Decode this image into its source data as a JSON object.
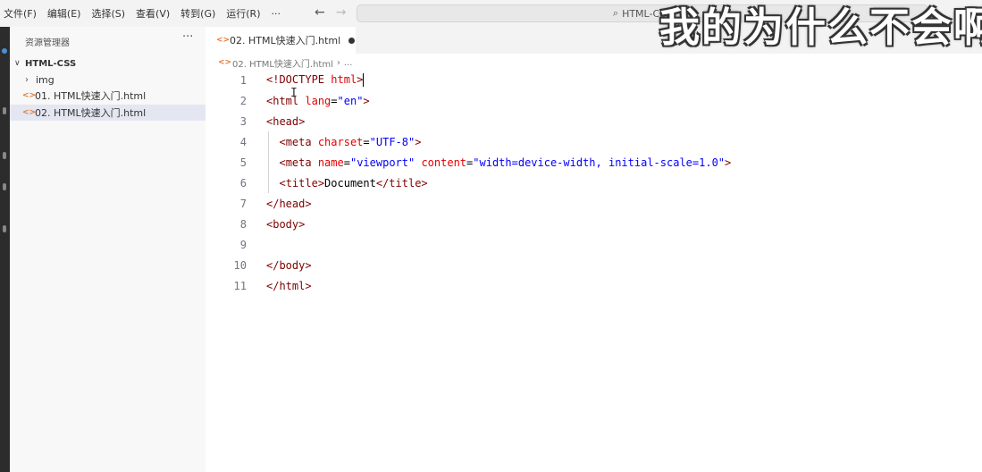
{
  "menu": [
    "文件(F)",
    "编辑(E)",
    "选择(S)",
    "查看(V)",
    "转到(G)",
    "运行(R)",
    "···"
  ],
  "nav": {
    "back": "←",
    "forward": "→"
  },
  "command_center": {
    "label": "HTML-CSS",
    "icon": "search-icon"
  },
  "overlay_caption": "我的为什么不会啊",
  "sidebar": {
    "title": "资源管理器",
    "more": "···",
    "folder": {
      "chevron": "∨",
      "name": "HTML-CSS"
    },
    "items": [
      {
        "type": "folder",
        "chevron": "›",
        "label": "img"
      },
      {
        "type": "file",
        "icon": "html-file-icon",
        "glyph": "<>",
        "label": "01. HTML快速入门.html"
      },
      {
        "type": "file",
        "icon": "html-file-icon",
        "glyph": "<>",
        "label": "02. HTML快速入门.html",
        "selected": true
      }
    ]
  },
  "tab": {
    "glyph": "<>",
    "label": "02. HTML快速入门.html",
    "dirty": true
  },
  "breadcrumbs": {
    "glyph": "<>",
    "file": "02. HTML快速入门.html",
    "sep": "›",
    "rest": "..."
  },
  "editor": {
    "lines": [
      {
        "n": "1",
        "text": "<!DOCTYPE html>"
      },
      {
        "n": "2",
        "text": "<html lang=\"en\">"
      },
      {
        "n": "3",
        "text": "<head>"
      },
      {
        "n": "4",
        "text": "  <meta charset=\"UTF-8\">"
      },
      {
        "n": "5",
        "text": "  <meta name=\"viewport\" content=\"width=device-width, initial-scale=1.0\">"
      },
      {
        "n": "6",
        "text": "  <title>Document</title>"
      },
      {
        "n": "7",
        "text": "</head>"
      },
      {
        "n": "8",
        "text": "<body>"
      },
      {
        "n": "9",
        "text": ""
      },
      {
        "n": "10",
        "text": "</body>"
      },
      {
        "n": "11",
        "text": "</html>"
      }
    ]
  },
  "colors": {
    "tag": "#800000",
    "attr": "#e50000",
    "string": "#0000ff",
    "gutter": "#6e7681",
    "accent": "#4a90d9"
  }
}
